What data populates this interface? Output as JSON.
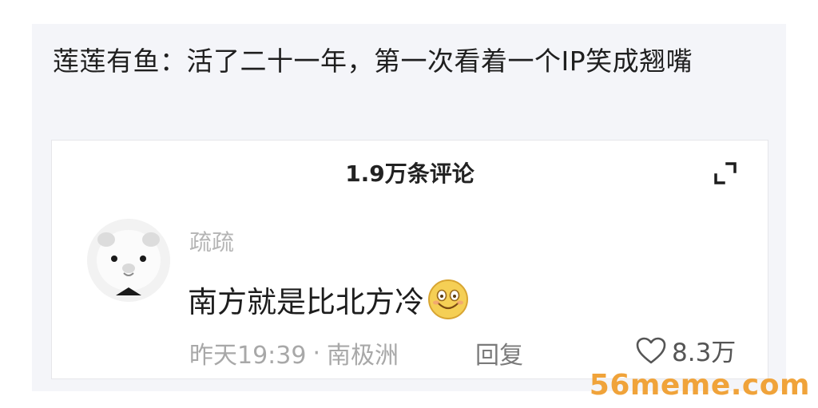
{
  "post": {
    "text": "莲莲有鱼：活了二十一年，第一次看着一个IP笑成翘嘴"
  },
  "comments_panel": {
    "header": "1.9万条评论",
    "expand_icon": "expand-icon"
  },
  "comment": {
    "avatar_icon": "hamster-avatar",
    "username": "疏疏",
    "text": "南方就是比北方冷",
    "emoji": "smiling-face-emoji",
    "time": "昨天19:39",
    "separator": "·",
    "location": "南极洲",
    "reply_label": "回复",
    "like_icon": "heart-icon",
    "like_count": "8.3万"
  },
  "watermark": {
    "text": "56meme.com"
  },
  "colors": {
    "card_background": "#f4f5f9",
    "watermark": "#f0a33a",
    "muted_text": "#a8a8a8"
  }
}
